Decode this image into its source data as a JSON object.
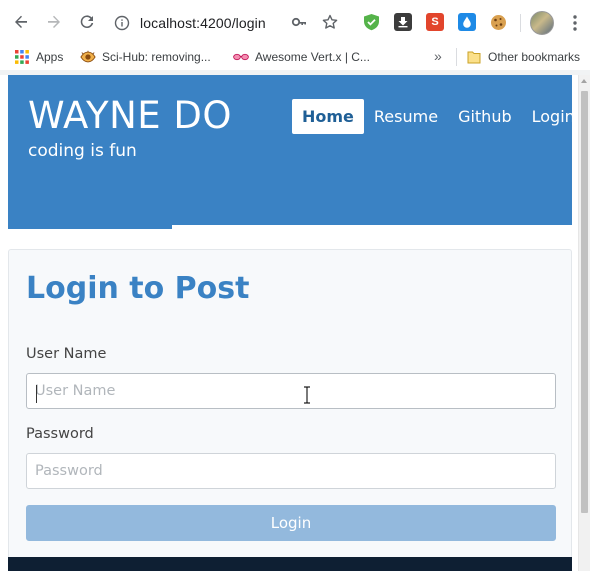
{
  "browser": {
    "url": "localhost:4200/login",
    "bookmarks": [
      {
        "label": "Apps",
        "icon": "apps-grid-icon"
      },
      {
        "label": "Sci-Hub: removing...",
        "icon": "eye-icon"
      },
      {
        "label": "Awesome Vert.x | C...",
        "icon": "glasses-icon"
      }
    ],
    "other_bookmarks": "Other bookmarks",
    "ext_s_label": "S"
  },
  "header": {
    "brand": "WAYNE DO",
    "tagline": "coding is fun",
    "nav": [
      {
        "label": "Home",
        "active": true
      },
      {
        "label": "Resume",
        "active": false
      },
      {
        "label": "Github",
        "active": false
      },
      {
        "label": "Login",
        "active": false
      }
    ]
  },
  "login": {
    "title": "Login to Post",
    "username_label": "User Name",
    "username_placeholder": "User Name",
    "username_value": "",
    "password_label": "Password",
    "password_placeholder": "Password",
    "password_value": "",
    "submit_label": "Login"
  },
  "colors": {
    "brand_blue": "#3a82c4",
    "button_disabled": "#93b9dd",
    "footer": "#0e1f33"
  }
}
